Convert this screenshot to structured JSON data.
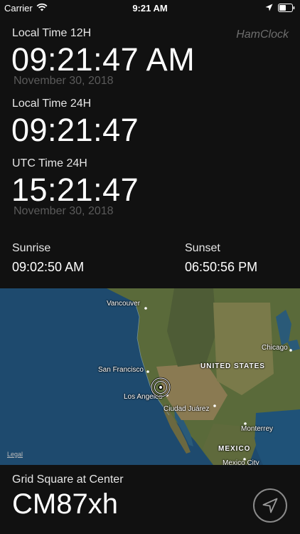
{
  "status_bar": {
    "carrier": "Carrier",
    "time": "9:21 AM",
    "icons": [
      "wifi-icon",
      "location-arrow-icon",
      "battery-icon"
    ]
  },
  "app": {
    "name": "HamClock"
  },
  "clocks": {
    "local12": {
      "label": "Local Time 12H",
      "time": "09:21:47 AM",
      "date": "November 30, 2018"
    },
    "local24": {
      "label": "Local Time 24H",
      "time": "09:21:47"
    },
    "utc24": {
      "label": "UTC Time 24H",
      "time": "15:21:47",
      "date": "November 30, 2018"
    }
  },
  "sun": {
    "sunrise_label": "Sunrise",
    "sunrise": "09:02:50 AM",
    "sunset_label": "Sunset",
    "sunset": "06:50:56 PM"
  },
  "map": {
    "labels": {
      "vancouver": "Vancouver",
      "chicago": "Chicago",
      "united_states": "UNITED STATES",
      "san_francisco": "San Francisco",
      "los_angeles": "Los Angeles",
      "ciudad_juarez": "Ciudad Juárez",
      "monterrey": "Monterrey",
      "mexico": "MEXICO",
      "mexico_city": "Mexico City"
    },
    "legal": "Legal",
    "marker": "target-marker-icon"
  },
  "grid": {
    "label": "Grid Square at Center",
    "value": "CM87xh",
    "locate_icon": "location-arrow-icon"
  },
  "colors": {
    "background": "#111111",
    "ocean": "#1e4a6e",
    "land": "#5a6a3a",
    "muted_text": "#5a5a5a"
  }
}
